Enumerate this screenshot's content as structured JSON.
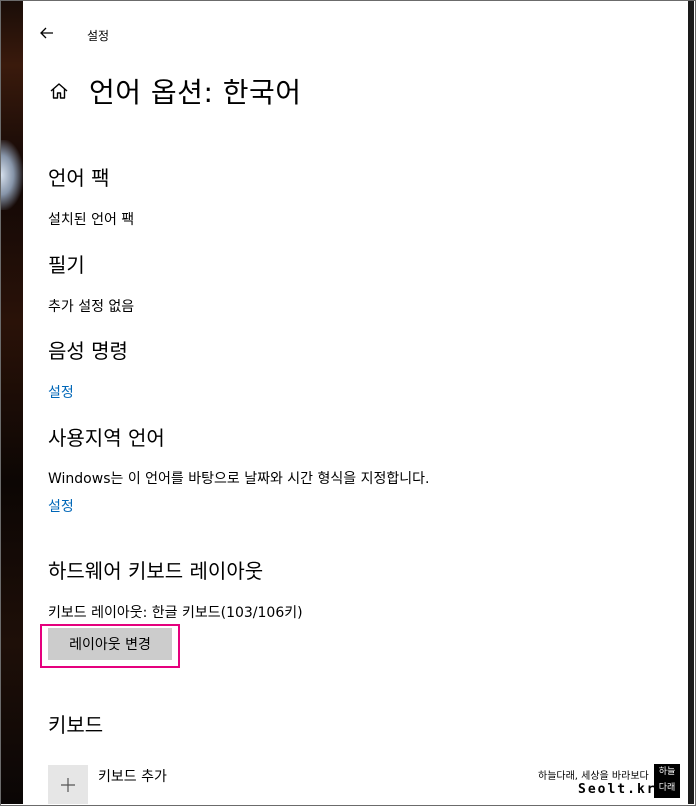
{
  "window": {
    "title": "설정"
  },
  "page": {
    "title": "언어 옵션: 한국어"
  },
  "sections": {
    "language_pack": {
      "heading": "언어 팩",
      "text": "설치된 언어 팩"
    },
    "handwriting": {
      "heading": "필기",
      "text": "추가 설정 없음"
    },
    "speech": {
      "heading": "음성 명령",
      "link": "설정"
    },
    "regional": {
      "heading": "사용지역 언어",
      "text": "Windows는 이 언어를 바탕으로 날짜와 시간 형식을 지정합니다.",
      "link": "설정"
    },
    "hardware_keyboard": {
      "heading": "하드웨어 키보드 레이아웃",
      "text": "키보드 레이아웃: 한글 키보드(103/106키)",
      "button": "레이아웃 변경"
    },
    "keyboards": {
      "heading": "키보드",
      "add_label": "키보드 추가"
    }
  },
  "watermark": {
    "line1": "하늘다래, 세상을 바라보다",
    "line2": "Seolt.kr",
    "logo_top": "하늘",
    "logo_bottom": "다래"
  },
  "icons": {
    "back": "back-arrow-icon",
    "home": "home-icon",
    "add": "plus-icon"
  }
}
